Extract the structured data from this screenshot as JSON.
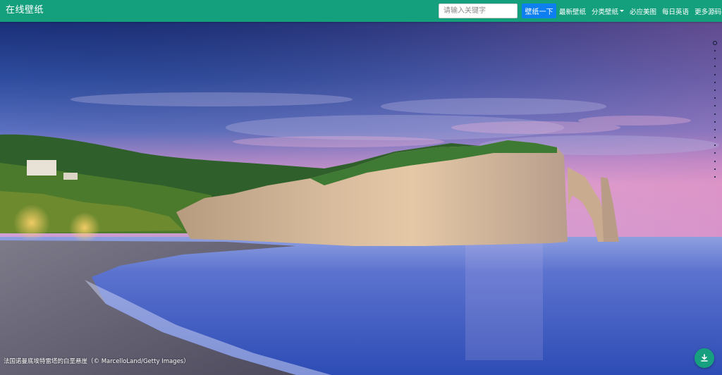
{
  "header": {
    "brand": "在线壁纸",
    "search": {
      "placeholder": "请输入关键字",
      "value": ""
    },
    "search_button": "壁纸一下",
    "nav": [
      {
        "label": "最新壁纸",
        "has_dropdown": false
      },
      {
        "label": "分类壁纸",
        "has_dropdown": true
      },
      {
        "label": "必应美图",
        "has_dropdown": false
      },
      {
        "label": "每日英语",
        "has_dropdown": false
      },
      {
        "label": "更多源码",
        "has_dropdown": false
      }
    ]
  },
  "wallpaper": {
    "caption": "法国诺曼底埃特雷塔的白垩悬崖（© MarcelloLand/Getty Images）",
    "download_icon": "download-icon"
  },
  "pager": {
    "count": 18,
    "active_index": 0
  },
  "colors": {
    "navbar": "#15a07d",
    "search_button": "#0d7ff0",
    "download_button": "#17a07f"
  }
}
